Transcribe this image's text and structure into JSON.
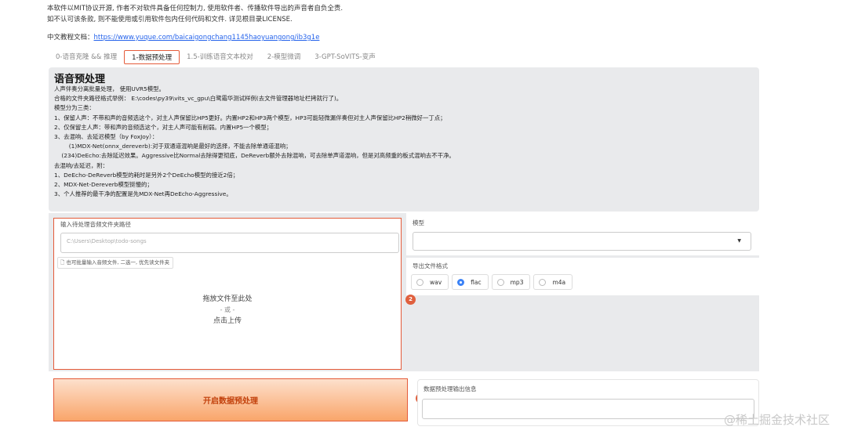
{
  "notice": {
    "line1": "本软件以MIT协议开源, 作者不对软件具备任何控制力, 使用软件者、传播软件导出的声音者自负全责.",
    "line2": "如不认可该条款, 则不能使用或引用软件包内任何代码和文件. 详见根目录LICENSE.",
    "tutorial_label": "中文教程文档：",
    "tutorial_link": "https://www.yuque.com/baicaigongchang1145haoyuangong/ib3g1e"
  },
  "tabs": [
    {
      "label": "0-语音克隆 && 推理",
      "active": false
    },
    {
      "label": "1-数据预处理",
      "active": true
    },
    {
      "label": "1.5-训练语音文本校对",
      "active": false
    },
    {
      "label": "2-模型微调",
      "active": false
    },
    {
      "label": "3-GPT-SoVITS-变声",
      "active": false
    }
  ],
  "markers": [
    "1",
    "2",
    "3"
  ],
  "section": {
    "title": "语音预处理",
    "lines": [
      "人声伴奏分离批量处理， 使用UVR5模型。",
      "合格的文件夹路径格式举例： E:\\codes\\py39\\vits_vc_gpu\\白鹭霜华测试样例(去文件管理器地址栏拷就行了)。",
      "模型分为三类：",
      "1、保留人声：不带和声的音频选这个，对主人声保留比HP5更好。内置HP2和HP3两个模型，HP3可能轻微漏伴奏但对主人声保留比HP2稍微好一丁点；",
      "2、仅保留主人声：带和声的音频选这个，对主人声可能有削弱。内置HP5一个模型；",
      "3、去混响、去延迟模型（by FoxJoy）：",
      "        (1)MDX-Net(onnx_dereverb):对于双通道混响是最好的选择，不能去除单通道混响；",
      "    (234)DeEcho:去除延迟效果。Aggressive比Normal去除得更彻底，DeReverb额外去除混响，可去除单声道混响，但是对高频重的板式混响去不干净。",
      "去混响/去延迟，附：",
      "1、DeEcho-DeReverb模型的耗时是另外2个DeEcho模型的接近2倍；",
      "2、MDX-Net-Dereverb模型挺慢的；",
      "3、个人推荐的最干净的配置是先MDX-Net再DeEcho-Aggressive。"
    ]
  },
  "upload": {
    "label": "输入待处理音频文件夹路径",
    "placeholder": "C:\\Users\\Desktop\\todo-songs",
    "hint": "也可批量输入音频文件, 二选一, 优先读文件夹",
    "drop_text": "拖放文件至此处",
    "or_text": "- 或 -",
    "click_text": "点击上传"
  },
  "model": {
    "label": "模型",
    "value": ""
  },
  "format": {
    "label": "导出文件格式",
    "options": [
      "wav",
      "flac",
      "mp3",
      "m4a"
    ],
    "selected": "flac"
  },
  "run_button": "开启数据预处理",
  "output": {
    "label": "数据预处理输出信息",
    "value": ""
  },
  "watermark": "@稀土掘金技术社区",
  "colors": {
    "accent": "#e45b3a",
    "panel_bg": "#e9eaec",
    "radio_selected": "#3b82f6"
  }
}
